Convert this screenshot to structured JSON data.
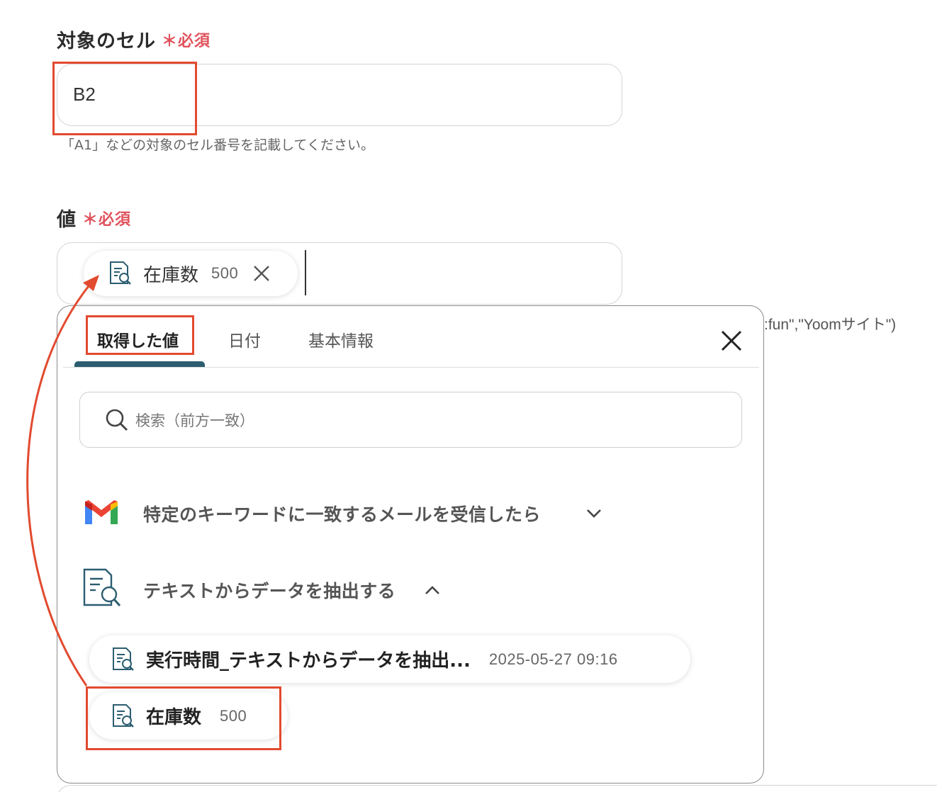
{
  "target_cell": {
    "label": "対象のセル",
    "required_mark": "＊",
    "required_text": "必須",
    "value": "B2",
    "help": "「A1」などの対象のセル番号を記載してください。"
  },
  "value_field": {
    "label": "値",
    "required_mark": "＊",
    "required_text": "必須",
    "chip": {
      "name": "在庫数",
      "value": "500"
    }
  },
  "background_hint": ":fun\",\"Yoomサイト\")",
  "picker": {
    "tabs": [
      {
        "label": "取得した値",
        "active": true
      },
      {
        "label": "日付",
        "active": false
      },
      {
        "label": "基本情報",
        "active": false
      }
    ],
    "search_placeholder": "検索（前方一致）",
    "groups": [
      {
        "title": "特定のキーワードに一致するメールを受信したら",
        "icon": "gmail-icon",
        "expanded": false
      },
      {
        "title": "テキストからデータを抽出する",
        "icon": "text-extract-icon",
        "expanded": true
      }
    ],
    "items": [
      {
        "name": "実行時間_テキストからデータを抽出...",
        "value": "2025-05-27 09:16"
      },
      {
        "name": "在庫数",
        "value": "500"
      }
    ]
  },
  "colors": {
    "required": "#e0525c",
    "highlight": "#e24a2f",
    "tab_active": "#2c5d70",
    "icon": "#2c5d70"
  }
}
